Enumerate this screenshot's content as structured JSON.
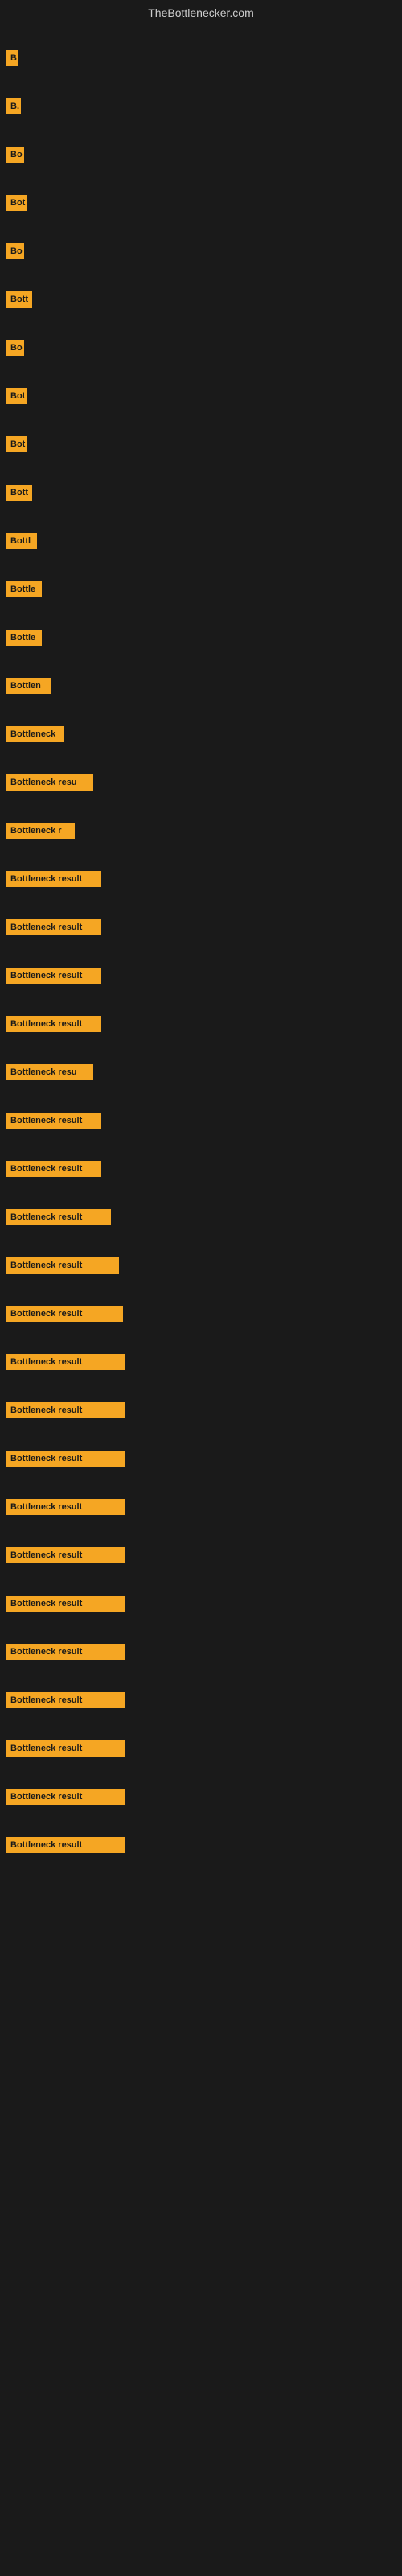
{
  "site": {
    "title": "TheBottlenecker.com"
  },
  "bars": [
    {
      "id": 1,
      "label": "B",
      "width": 14
    },
    {
      "id": 2,
      "label": "B.",
      "width": 18
    },
    {
      "id": 3,
      "label": "Bo",
      "width": 22
    },
    {
      "id": 4,
      "label": "Bot",
      "width": 26
    },
    {
      "id": 5,
      "label": "Bo",
      "width": 22
    },
    {
      "id": 6,
      "label": "Bott",
      "width": 32
    },
    {
      "id": 7,
      "label": "Bo",
      "width": 22
    },
    {
      "id": 8,
      "label": "Bot",
      "width": 26
    },
    {
      "id": 9,
      "label": "Bot",
      "width": 26
    },
    {
      "id": 10,
      "label": "Bott",
      "width": 32
    },
    {
      "id": 11,
      "label": "Bottl",
      "width": 38
    },
    {
      "id": 12,
      "label": "Bottle",
      "width": 44
    },
    {
      "id": 13,
      "label": "Bottle",
      "width": 44
    },
    {
      "id": 14,
      "label": "Bottlen",
      "width": 55
    },
    {
      "id": 15,
      "label": "Bottleneck",
      "width": 72
    },
    {
      "id": 16,
      "label": "Bottleneck resu",
      "width": 108
    },
    {
      "id": 17,
      "label": "Bottleneck r",
      "width": 85
    },
    {
      "id": 18,
      "label": "Bottleneck result",
      "width": 118
    },
    {
      "id": 19,
      "label": "Bottleneck result",
      "width": 118
    },
    {
      "id": 20,
      "label": "Bottleneck result",
      "width": 118
    },
    {
      "id": 21,
      "label": "Bottleneck result",
      "width": 118
    },
    {
      "id": 22,
      "label": "Bottleneck resu",
      "width": 108
    },
    {
      "id": 23,
      "label": "Bottleneck result",
      "width": 118
    },
    {
      "id": 24,
      "label": "Bottleneck result",
      "width": 118
    },
    {
      "id": 25,
      "label": "Bottleneck result",
      "width": 130
    },
    {
      "id": 26,
      "label": "Bottleneck result",
      "width": 140
    },
    {
      "id": 27,
      "label": "Bottleneck result",
      "width": 145
    },
    {
      "id": 28,
      "label": "Bottleneck result",
      "width": 148
    },
    {
      "id": 29,
      "label": "Bottleneck result",
      "width": 148
    },
    {
      "id": 30,
      "label": "Bottleneck result",
      "width": 148
    },
    {
      "id": 31,
      "label": "Bottleneck result",
      "width": 148
    },
    {
      "id": 32,
      "label": "Bottleneck result",
      "width": 148
    },
    {
      "id": 33,
      "label": "Bottleneck result",
      "width": 148
    },
    {
      "id": 34,
      "label": "Bottleneck result",
      "width": 148
    },
    {
      "id": 35,
      "label": "Bottleneck result",
      "width": 148
    },
    {
      "id": 36,
      "label": "Bottleneck result",
      "width": 148
    },
    {
      "id": 37,
      "label": "Bottleneck result",
      "width": 148
    },
    {
      "id": 38,
      "label": "Bottleneck result",
      "width": 148
    }
  ]
}
